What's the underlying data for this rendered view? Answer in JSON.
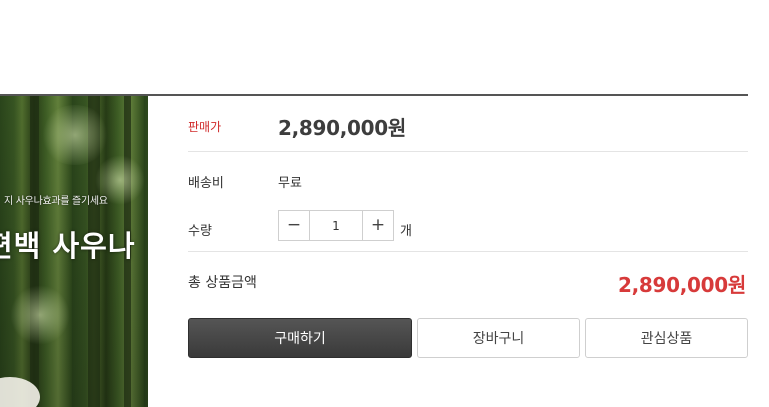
{
  "image": {
    "caption_small": "지 사우나효과를 즐기세요",
    "caption_big": "편백 사우나"
  },
  "product": {
    "price_label": "판매가",
    "price_value": "2,890,000원",
    "shipping_label": "배송비",
    "shipping_value": "무료",
    "quantity_label": "수량",
    "quantity_value": "1",
    "quantity_minus": "−",
    "quantity_plus": "+",
    "quantity_unit": "개",
    "total_label": "총 상품금액",
    "total_value": "2,890,000원"
  },
  "actions": {
    "buy_label": "구매하기",
    "cart_label": "장바구니",
    "wish_label": "관심상품"
  },
  "colors": {
    "price_label": "#d02a2a",
    "total_price": "#d73a3a",
    "buy_button": "#3a3a3a"
  }
}
